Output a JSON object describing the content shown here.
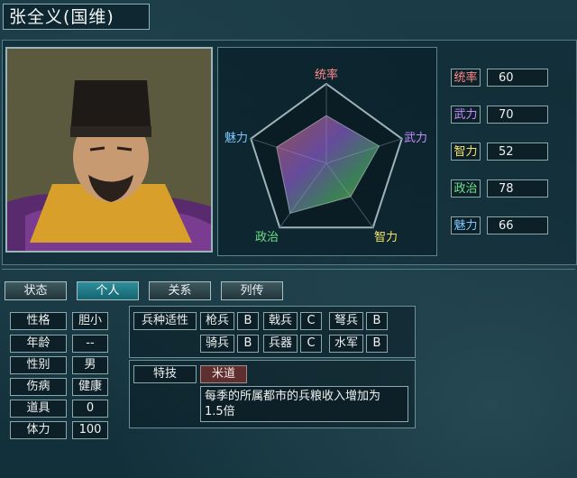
{
  "character": {
    "name": "张全义(国维)"
  },
  "colors": {
    "command": "#ff8a8a",
    "war": "#c68cff",
    "intel": "#f5e36a",
    "politics": "#6ee08a",
    "charm": "#7fc8ff",
    "skill_bg": "#5e2f2f"
  },
  "radar": {
    "labels": {
      "command": "统率",
      "war": "武力",
      "intel": "智力",
      "politics": "政治",
      "charm": "魅力"
    }
  },
  "stats": [
    {
      "label": "统率",
      "value": "60",
      "color": "#ff8a8a"
    },
    {
      "label": "武力",
      "value": "70",
      "color": "#c68cff"
    },
    {
      "label": "智力",
      "value": "52",
      "color": "#f5e36a"
    },
    {
      "label": "政治",
      "value": "78",
      "color": "#6ee08a"
    },
    {
      "label": "魅力",
      "value": "66",
      "color": "#7fc8ff"
    }
  ],
  "tabs": [
    {
      "label": "状态",
      "active": false
    },
    {
      "label": "个人",
      "active": true
    },
    {
      "label": "关系",
      "active": false
    },
    {
      "label": "列传",
      "active": false
    }
  ],
  "personal": [
    {
      "label": "性格",
      "value": "胆小"
    },
    {
      "label": "年龄",
      "value": "--"
    },
    {
      "label": "性别",
      "value": "男"
    },
    {
      "label": "伤病",
      "value": "健康"
    },
    {
      "label": "道具",
      "value": "0"
    },
    {
      "label": "体力",
      "value": "100"
    }
  ],
  "aptitude": {
    "title": "兵种适性",
    "items": [
      {
        "label": "枪兵",
        "value": "B"
      },
      {
        "label": "戟兵",
        "value": "C"
      },
      {
        "label": "弩兵",
        "value": "B"
      },
      {
        "label": "骑兵",
        "value": "B"
      },
      {
        "label": "兵器",
        "value": "C"
      },
      {
        "label": "水军",
        "value": "B"
      }
    ]
  },
  "special": {
    "title": "特技",
    "name": "米道",
    "description_line1": "每季的所属都市的兵粮收入增加为",
    "description_line2": "1.5倍"
  }
}
